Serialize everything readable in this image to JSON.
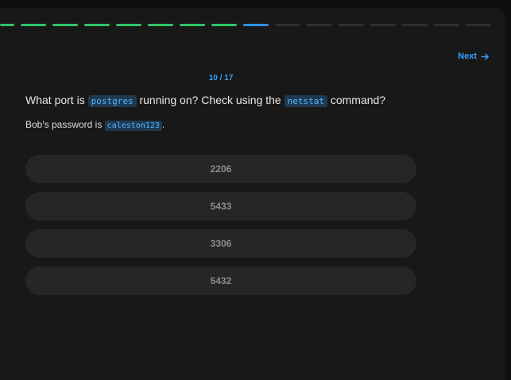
{
  "progress": {
    "total": 16,
    "done": 8,
    "current_index": 8
  },
  "nav": {
    "next_label": "Next"
  },
  "counter": "10 / 17",
  "question": {
    "part1": "What port is ",
    "code1": "postgres",
    "part2": " running on? Check using the ",
    "code2": "netstat",
    "part3": " command?"
  },
  "hint": {
    "prefix": "Bob's password is ",
    "code": "caleston123",
    "suffix": "."
  },
  "options": [
    {
      "label": "2206"
    },
    {
      "label": "5433"
    },
    {
      "label": "3306"
    },
    {
      "label": "5432"
    }
  ],
  "colors": {
    "done": "#2ec56a",
    "current": "#2f8fe6",
    "accent": "#3aa0ff"
  }
}
